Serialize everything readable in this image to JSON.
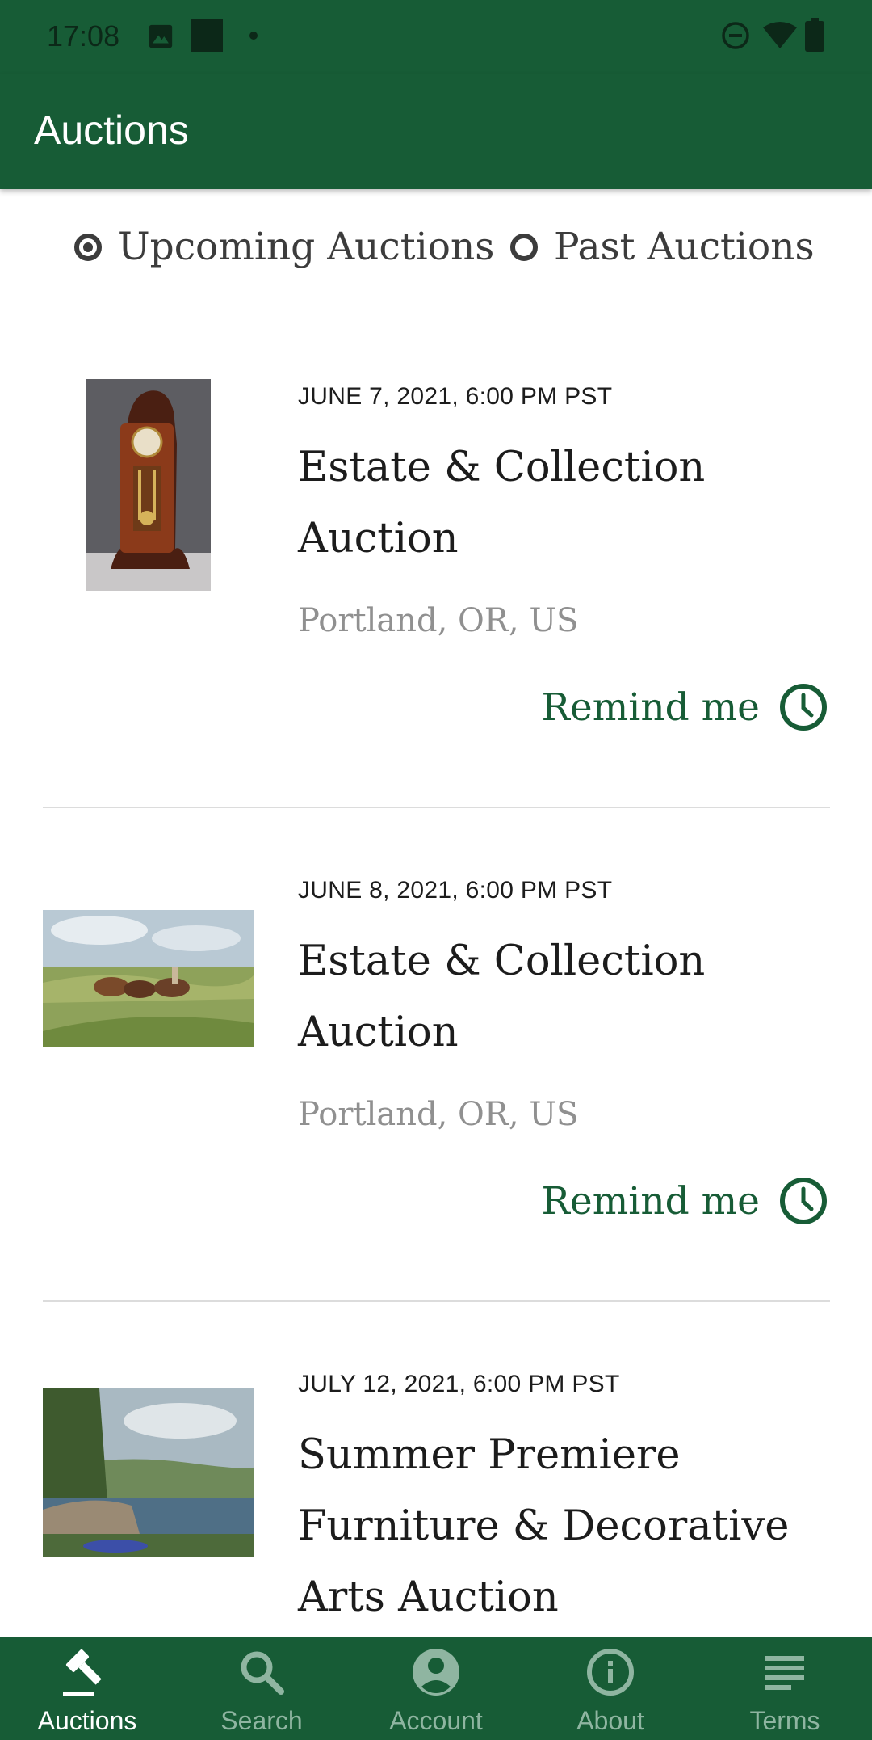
{
  "status_bar": {
    "time": "17:08",
    "left_icons": [
      "image-icon",
      "square-icon",
      "dot-icon"
    ],
    "right_icons": [
      "dnd-icon",
      "wifi-icon",
      "battery-icon"
    ]
  },
  "app_bar": {
    "title": "Auctions"
  },
  "filter": {
    "options": [
      {
        "label": "Upcoming Auctions",
        "selected": true
      },
      {
        "label": "Past Auctions",
        "selected": false
      }
    ]
  },
  "auctions": [
    {
      "date": "JUNE 7, 2021, 6:00 PM PST",
      "title": "Estate & Collection Auction",
      "location": "Portland, OR, US",
      "action": "Remind me",
      "image": "grandfather-clock-photo"
    },
    {
      "date": "JUNE 8, 2021, 6:00 PM PST",
      "title": "Estate & Collection Auction",
      "location": "Portland, OR, US",
      "action": "Remind me",
      "image": "horses-landscape-painting"
    },
    {
      "date": "JULY 12, 2021, 6:00 PM PST",
      "title": "Summer Premiere Furniture & Decorative Arts Auction",
      "image": "river-landscape-painting"
    }
  ],
  "colors": {
    "primary": "#175c36",
    "nav_inactive": "#8fb5a1",
    "location_text": "#909090"
  },
  "bottom_nav": {
    "items": [
      {
        "label": "Auctions",
        "icon": "gavel-icon",
        "active": true
      },
      {
        "label": "Search",
        "icon": "search-icon",
        "active": false
      },
      {
        "label": "Account",
        "icon": "account-icon",
        "active": false
      },
      {
        "label": "About",
        "icon": "info-icon",
        "active": false
      },
      {
        "label": "Terms",
        "icon": "terms-icon",
        "active": false
      }
    ]
  }
}
